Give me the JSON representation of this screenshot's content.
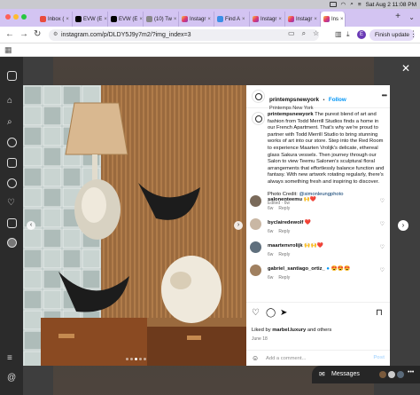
{
  "menubar": {
    "datetime": "Sat Aug 2  11:08 PM"
  },
  "tabs": [
    {
      "label": "Inbox (",
      "icon": "mail-icon",
      "favicon": "mail"
    },
    {
      "label": "EVW (E",
      "icon": "x-icon",
      "favicon": "x"
    },
    {
      "label": "EVW (E",
      "icon": "x-icon",
      "favicon": "x"
    },
    {
      "label": "(10) Tw",
      "icon": "x-icon",
      "favicon": "x2"
    },
    {
      "label": "Instagr",
      "icon": "instagram-icon",
      "favicon": "ig"
    },
    {
      "label": "Find A",
      "icon": "globe-icon",
      "favicon": "find"
    },
    {
      "label": "Instagr",
      "icon": "instagram-icon",
      "favicon": "ig"
    },
    {
      "label": "Instagr",
      "icon": "instagram-icon",
      "favicon": "ig"
    },
    {
      "label": "Ins",
      "icon": "instagram-icon",
      "favicon": "ig",
      "active": true
    }
  ],
  "browser": {
    "url": "instagram.com/p/DLDY5J9y7m2/?img_index=3",
    "profile_initial": "E",
    "finish_update_label": "Finish update"
  },
  "post": {
    "username": "printempsnewyork",
    "follow_label": "Follow",
    "location": "Printemps New York",
    "separator": "•",
    "caption_username": "printempsnewyork",
    "caption": "The purest blend of art and fashion from Todd Merrill Studios finds a home in our French Apartment. That's why we're proud to partner with Todd Merrill Studio to bring stunning works of art into our store. Step into the Red Room to experience Maarten Vrolijk's delicate, ethereal glass Sakura vessels. Then journey through our Salon to view Teemu Salonen's sculptural floral arrangements that effortlessly balance function and fantasy. With new artwork rotating regularly, there's always something fresh and inspiring to discover.",
    "credit_prefix": "Photo Credit: ",
    "credit_tag": "@simonleungphoto",
    "caption_meta": "Edited · 6w",
    "comments": [
      {
        "username": "salonenteemu",
        "text": "🙌❤️",
        "time": "6w",
        "reply": "Reply",
        "avatar_color": "#7a6a5a"
      },
      {
        "username": "byclairedewolf",
        "text": "❤️",
        "time": "6w",
        "reply": "Reply",
        "avatar_color": "#c9b7a4"
      },
      {
        "username": "maartenvrolijk",
        "text": "🙌🙌❤️",
        "time": "6w",
        "reply": "Reply",
        "avatar_color": "#5f6f7d"
      },
      {
        "username": "gabriel_santiago_ortiz_",
        "text": "😍😍😍",
        "time": "6w",
        "reply": "Reply",
        "avatar_color": "#a08060",
        "verified": "●"
      }
    ],
    "liked_prefix": "Liked by ",
    "liked_user": "marbel.luxury",
    "liked_suffix": " and others",
    "date": "June 18",
    "add_comment_placeholder": "Add a comment...",
    "post_label": "Post"
  },
  "messages": {
    "label": "Messages"
  },
  "colors": {
    "accent": "#0095f6",
    "tabstrip": "#d3c4f2",
    "heart_red": "#ed4956"
  }
}
